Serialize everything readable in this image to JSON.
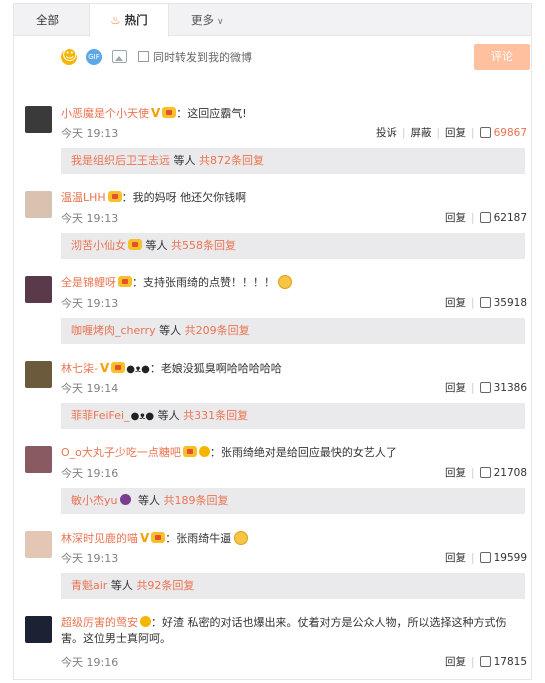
{
  "tabs": {
    "all": "全部",
    "hot": "热门",
    "more": "更多"
  },
  "toolbar": {
    "forward_label": "同时转发到我的微博",
    "submit_label": "评论"
  },
  "actions": {
    "report": "投诉",
    "block": "屏蔽",
    "reply": "回复"
  },
  "sub_suffix_mid": "等人",
  "comments": [
    {
      "user": "小恶魔是个小天使",
      "badge_v": "V",
      "text": "这回应霸气!",
      "time": "今天 19:13",
      "likes": "69867",
      "show_report": true,
      "sub_name": "我是组织后卫王志远",
      "sub_count": "共872条回复"
    },
    {
      "user": "温温LHH",
      "text": "我的妈呀 他还欠你钱啊",
      "time": "今天 19:13",
      "likes": "62187",
      "sub_name": "沏苦小仙女",
      "sub_count": "共558条回复"
    },
    {
      "user": "全是锦鲤呀",
      "text": "支持张雨绮的点赞！！！！",
      "time": "今天 19:13",
      "likes": "35918",
      "sub_name": "咖喱烤肉_cherry",
      "sub_count": "共209条回复"
    },
    {
      "user": "林七柒-",
      "badge_v": "V",
      "text": "老娘没狐臭啊哈哈哈哈哈",
      "time": "今天 19:14",
      "likes": "31386",
      "sub_name": "菲菲FeiFei_",
      "sub_count": "共331条回复"
    },
    {
      "user": "O_o大丸子少吃一点糖吧",
      "text": "张雨绮绝对是给回应最快的女艺人了",
      "time": "今天 19:16",
      "likes": "21708",
      "sub_name": "敏小杰yu",
      "sub_count": "共189条回复"
    },
    {
      "user": "林深时见鹿的喵",
      "badge_v": "V",
      "text": "张雨绮牛逼",
      "time": "今天 19:13",
      "likes": "19599",
      "sub_name": "青魁air",
      "sub_count": "共92条回复"
    },
    {
      "user": "超级厉害的莺安",
      "text": "好渣 私密的对话也爆出来。仗着对方是公众人物，所以选择这种方式伤害。这位男士真阿呵。",
      "time": "今天 19:16",
      "likes": "17815"
    }
  ],
  "colors": {
    "accent": "#eb7350",
    "sub_bg": "#eaeaec",
    "submit_bg": "#ffc09f"
  },
  "icons": [
    "fire-icon",
    "chevron-down-icon",
    "emoji-icon",
    "sticker-icon",
    "image-icon",
    "thumb-up-icon",
    "vip-crown-icon",
    "verified-v-icon",
    "panda-icon",
    "smile-emoji-icon"
  ]
}
